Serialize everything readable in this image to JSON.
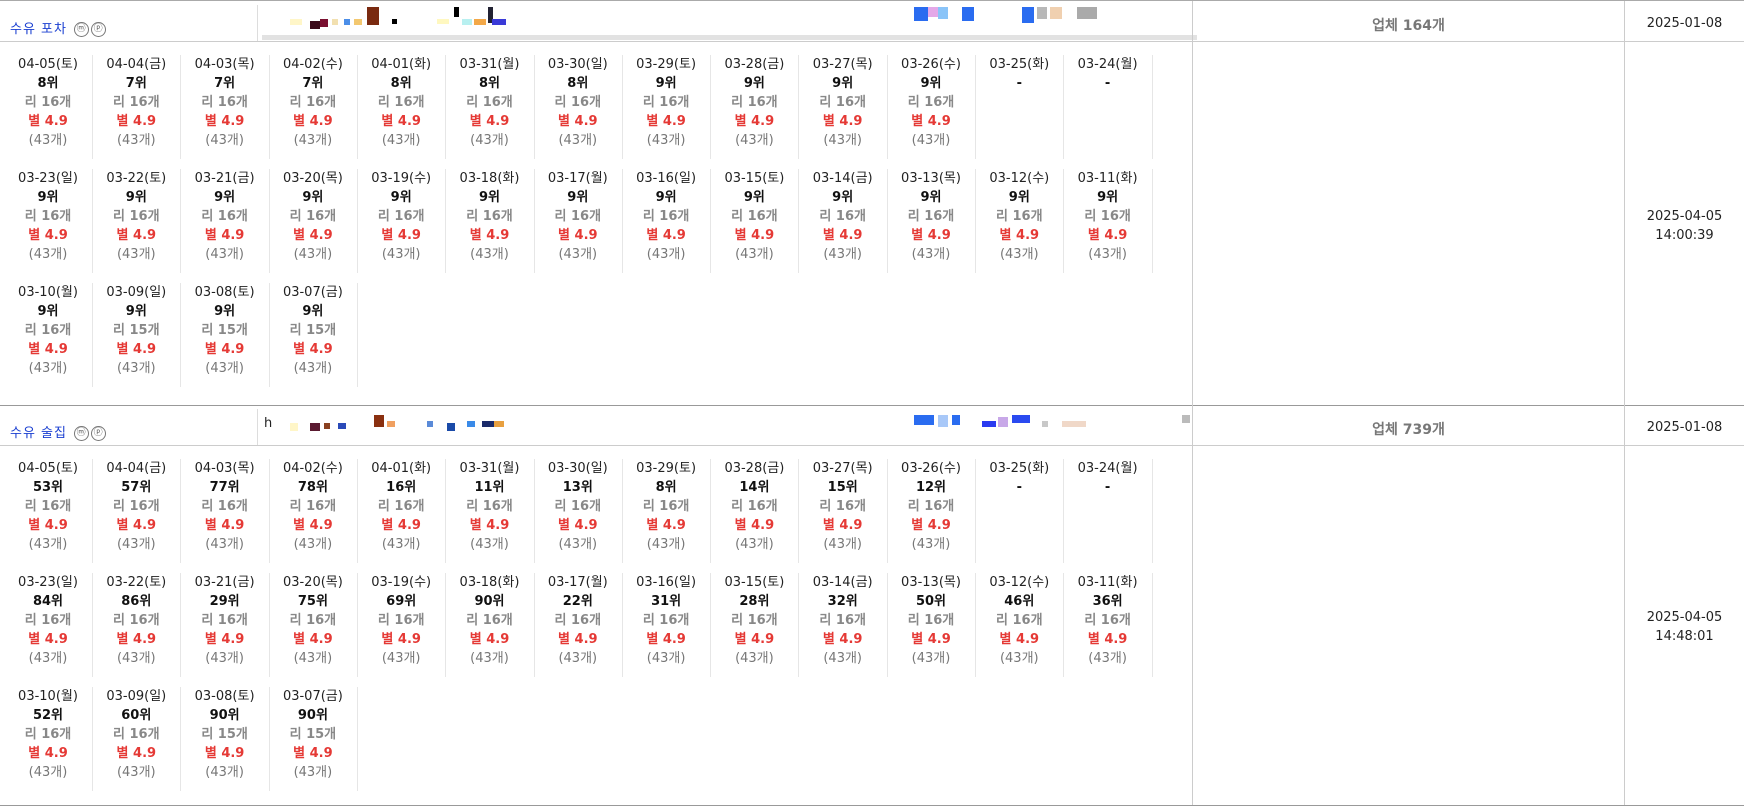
{
  "stores": [
    {
      "name": "수유 포차",
      "url_prefix": "",
      "business_count": "업체 164개",
      "start_date": "2025-01-08",
      "updated_date": "2025-04-05",
      "updated_time": "14:00:39",
      "days": [
        {
          "date": "04-05(토)",
          "rank": "8위",
          "reviews": "리 16개",
          "stars": "별 4.9",
          "count": "(43개)"
        },
        {
          "date": "04-04(금)",
          "rank": "7위",
          "reviews": "리 16개",
          "stars": "별 4.9",
          "count": "(43개)"
        },
        {
          "date": "04-03(목)",
          "rank": "7위",
          "reviews": "리 16개",
          "stars": "별 4.9",
          "count": "(43개)"
        },
        {
          "date": "04-02(수)",
          "rank": "7위",
          "reviews": "리 16개",
          "stars": "별 4.9",
          "count": "(43개)"
        },
        {
          "date": "04-01(화)",
          "rank": "8위",
          "reviews": "리 16개",
          "stars": "별 4.9",
          "count": "(43개)"
        },
        {
          "date": "03-31(월)",
          "rank": "8위",
          "reviews": "리 16개",
          "stars": "별 4.9",
          "count": "(43개)"
        },
        {
          "date": "03-30(일)",
          "rank": "8위",
          "reviews": "리 16개",
          "stars": "별 4.9",
          "count": "(43개)"
        },
        {
          "date": "03-29(토)",
          "rank": "9위",
          "reviews": "리 16개",
          "stars": "별 4.9",
          "count": "(43개)"
        },
        {
          "date": "03-28(금)",
          "rank": "9위",
          "reviews": "리 16개",
          "stars": "별 4.9",
          "count": "(43개)"
        },
        {
          "date": "03-27(목)",
          "rank": "9위",
          "reviews": "리 16개",
          "stars": "별 4.9",
          "count": "(43개)"
        },
        {
          "date": "03-26(수)",
          "rank": "9위",
          "reviews": "리 16개",
          "stars": "별 4.9",
          "count": "(43개)"
        },
        {
          "date": "03-25(화)",
          "rank": "-",
          "reviews": "",
          "stars": "",
          "count": ""
        },
        {
          "date": "03-24(월)",
          "rank": "-",
          "reviews": "",
          "stars": "",
          "count": ""
        },
        {
          "date": "03-23(일)",
          "rank": "9위",
          "reviews": "리 16개",
          "stars": "별 4.9",
          "count": "(43개)"
        },
        {
          "date": "03-22(토)",
          "rank": "9위",
          "reviews": "리 16개",
          "stars": "별 4.9",
          "count": "(43개)"
        },
        {
          "date": "03-21(금)",
          "rank": "9위",
          "reviews": "리 16개",
          "stars": "별 4.9",
          "count": "(43개)"
        },
        {
          "date": "03-20(목)",
          "rank": "9위",
          "reviews": "리 16개",
          "stars": "별 4.9",
          "count": "(43개)"
        },
        {
          "date": "03-19(수)",
          "rank": "9위",
          "reviews": "리 16개",
          "stars": "별 4.9",
          "count": "(43개)"
        },
        {
          "date": "03-18(화)",
          "rank": "9위",
          "reviews": "리 16개",
          "stars": "별 4.9",
          "count": "(43개)"
        },
        {
          "date": "03-17(월)",
          "rank": "9위",
          "reviews": "리 16개",
          "stars": "별 4.9",
          "count": "(43개)"
        },
        {
          "date": "03-16(일)",
          "rank": "9위",
          "reviews": "리 16개",
          "stars": "별 4.9",
          "count": "(43개)"
        },
        {
          "date": "03-15(토)",
          "rank": "9위",
          "reviews": "리 16개",
          "stars": "별 4.9",
          "count": "(43개)"
        },
        {
          "date": "03-14(금)",
          "rank": "9위",
          "reviews": "리 16개",
          "stars": "별 4.9",
          "count": "(43개)"
        },
        {
          "date": "03-13(목)",
          "rank": "9위",
          "reviews": "리 16개",
          "stars": "별 4.9",
          "count": "(43개)"
        },
        {
          "date": "03-12(수)",
          "rank": "9위",
          "reviews": "리 16개",
          "stars": "별 4.9",
          "count": "(43개)"
        },
        {
          "date": "03-11(화)",
          "rank": "9위",
          "reviews": "리 16개",
          "stars": "별 4.9",
          "count": "(43개)"
        },
        {
          "date": "03-10(월)",
          "rank": "9위",
          "reviews": "리 16개",
          "stars": "별 4.9",
          "count": "(43개)"
        },
        {
          "date": "03-09(일)",
          "rank": "9위",
          "reviews": "리 15개",
          "stars": "별 4.9",
          "count": "(43개)"
        },
        {
          "date": "03-08(토)",
          "rank": "9위",
          "reviews": "리 15개",
          "stars": "별 4.9",
          "count": "(43개)"
        },
        {
          "date": "03-07(금)",
          "rank": "9위",
          "reviews": "리 15개",
          "stars": "별 4.9",
          "count": "(43개)"
        }
      ]
    },
    {
      "name": "수유 술집",
      "url_prefix": "h",
      "business_count": "업체 739개",
      "start_date": "2025-01-08",
      "updated_date": "2025-04-05",
      "updated_time": "14:48:01",
      "days": [
        {
          "date": "04-05(토)",
          "rank": "53위",
          "reviews": "리 16개",
          "stars": "별 4.9",
          "count": "(43개)"
        },
        {
          "date": "04-04(금)",
          "rank": "57위",
          "reviews": "리 16개",
          "stars": "별 4.9",
          "count": "(43개)"
        },
        {
          "date": "04-03(목)",
          "rank": "77위",
          "reviews": "리 16개",
          "stars": "별 4.9",
          "count": "(43개)"
        },
        {
          "date": "04-02(수)",
          "rank": "78위",
          "reviews": "리 16개",
          "stars": "별 4.9",
          "count": "(43개)"
        },
        {
          "date": "04-01(화)",
          "rank": "16위",
          "reviews": "리 16개",
          "stars": "별 4.9",
          "count": "(43개)"
        },
        {
          "date": "03-31(월)",
          "rank": "11위",
          "reviews": "리 16개",
          "stars": "별 4.9",
          "count": "(43개)"
        },
        {
          "date": "03-30(일)",
          "rank": "13위",
          "reviews": "리 16개",
          "stars": "별 4.9",
          "count": "(43개)"
        },
        {
          "date": "03-29(토)",
          "rank": "8위",
          "reviews": "리 16개",
          "stars": "별 4.9",
          "count": "(43개)"
        },
        {
          "date": "03-28(금)",
          "rank": "14위",
          "reviews": "리 16개",
          "stars": "별 4.9",
          "count": "(43개)"
        },
        {
          "date": "03-27(목)",
          "rank": "15위",
          "reviews": "리 16개",
          "stars": "별 4.9",
          "count": "(43개)"
        },
        {
          "date": "03-26(수)",
          "rank": "12위",
          "reviews": "리 16개",
          "stars": "별 4.9",
          "count": "(43개)"
        },
        {
          "date": "03-25(화)",
          "rank": "-",
          "reviews": "",
          "stars": "",
          "count": ""
        },
        {
          "date": "03-24(월)",
          "rank": "-",
          "reviews": "",
          "stars": "",
          "count": ""
        },
        {
          "date": "03-23(일)",
          "rank": "84위",
          "reviews": "리 16개",
          "stars": "별 4.9",
          "count": "(43개)"
        },
        {
          "date": "03-22(토)",
          "rank": "86위",
          "reviews": "리 16개",
          "stars": "별 4.9",
          "count": "(43개)"
        },
        {
          "date": "03-21(금)",
          "rank": "29위",
          "reviews": "리 16개",
          "stars": "별 4.9",
          "count": "(43개)"
        },
        {
          "date": "03-20(목)",
          "rank": "75위",
          "reviews": "리 16개",
          "stars": "별 4.9",
          "count": "(43개)"
        },
        {
          "date": "03-19(수)",
          "rank": "69위",
          "reviews": "리 16개",
          "stars": "별 4.9",
          "count": "(43개)"
        },
        {
          "date": "03-18(화)",
          "rank": "90위",
          "reviews": "리 16개",
          "stars": "별 4.9",
          "count": "(43개)"
        },
        {
          "date": "03-17(월)",
          "rank": "22위",
          "reviews": "리 16개",
          "stars": "별 4.9",
          "count": "(43개)"
        },
        {
          "date": "03-16(일)",
          "rank": "31위",
          "reviews": "리 16개",
          "stars": "별 4.9",
          "count": "(43개)"
        },
        {
          "date": "03-15(토)",
          "rank": "28위",
          "reviews": "리 16개",
          "stars": "별 4.9",
          "count": "(43개)"
        },
        {
          "date": "03-14(금)",
          "rank": "32위",
          "reviews": "리 16개",
          "stars": "별 4.9",
          "count": "(43개)"
        },
        {
          "date": "03-13(목)",
          "rank": "50위",
          "reviews": "리 16개",
          "stars": "별 4.9",
          "count": "(43개)"
        },
        {
          "date": "03-12(수)",
          "rank": "46위",
          "reviews": "리 16개",
          "stars": "별 4.9",
          "count": "(43개)"
        },
        {
          "date": "03-11(화)",
          "rank": "36위",
          "reviews": "리 16개",
          "stars": "별 4.9",
          "count": "(43개)"
        },
        {
          "date": "03-10(월)",
          "rank": "52위",
          "reviews": "리 16개",
          "stars": "별 4.9",
          "count": "(43개)"
        },
        {
          "date": "03-09(일)",
          "rank": "60위",
          "reviews": "리 16개",
          "stars": "별 4.9",
          "count": "(43개)"
        },
        {
          "date": "03-08(토)",
          "rank": "90위",
          "reviews": "리 15개",
          "stars": "별 4.9",
          "count": "(43개)"
        },
        {
          "date": "03-07(금)",
          "rank": "90위",
          "reviews": "리 15개",
          "stars": "별 4.9",
          "count": "(43개)"
        }
      ]
    }
  ],
  "icons": {
    "m": "ⓜ",
    "p": "ⓟ"
  }
}
